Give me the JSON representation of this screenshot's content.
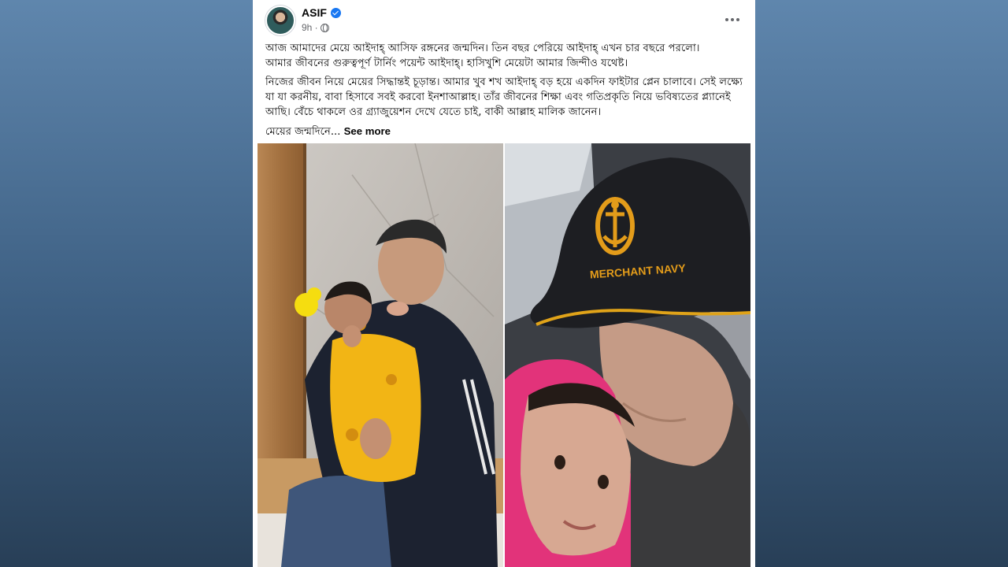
{
  "post": {
    "author": "ASIF",
    "time": "9h ·",
    "paragraphs": [
      "আজ আমাদের মেয়ে আইদাহ্ আসিফ রঙ্গনের জন্মদিন। তিন বছর পেরিয়ে আইদাহ্ এখন চার বছরে পরলো।\nআমার জীবনের গুরুত্বপূর্ণ টার্নিং পয়েন্ট আইদাহ্। হাসিখুশি মেয়েটা আমার জিন্দীও যথেষ্ট।",
      "নিজের জীবন নিয়ে মেয়ের সিদ্ধান্তই চূড়ান্ত। আমার খুব শখ আইদাহ্ বড় হয়ে একদিন ফাইটার প্লেন চালাবে। সেই লক্ষ্যে যা যা করনীয়, বাবা হিসাবে সবই করবো ইনশাআল্লাহ। তাঁর জীবনের শিক্ষা এবং গতিপ্রকৃতি নিয়ে ভবিষ্যতের প্ল্যানেই আছি। বেঁচে থাকলে ওর গ্র্যাজুয়েশন দেখে যেতে চাই, বাকী আল্লাহ মালিক জানেন।"
    ],
    "truncated_text": "মেয়ের জন্মদিনে...",
    "see_more": "See more",
    "cap_text": "MERCHANT NAVY"
  },
  "icons": {
    "verified": "verified-badge-icon",
    "privacy": "globe-icon",
    "more": "more-options-icon"
  },
  "colors": {
    "background_top": "#5f86ad",
    "background_bottom": "#283f57",
    "card": "#ffffff",
    "verified": "#1877f2",
    "meta_text": "#65676b"
  }
}
